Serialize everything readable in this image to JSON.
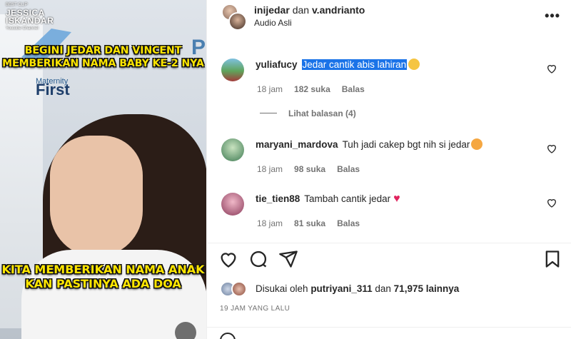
{
  "media": {
    "brand_name": "JESSICA ISKANDAR",
    "brand_sub": "Youtube Channel",
    "brand_tag": "BEST CLIP",
    "backdrop_word": "Maternity",
    "backdrop_word2": "First",
    "backdrop_letter": "P",
    "caption_top_line1": "BEGINI JEDAR DAN VINCENT",
    "caption_top_line2": "MEMBERIKAN NAMA BABY KE-2 NYA",
    "caption_bottom_line1": "KITA MEMBERIKAN NAMA ANAK",
    "caption_bottom_line2": "KAN PASTINYA ADA DOA"
  },
  "header": {
    "user1": "inijedar",
    "joiner": "dan",
    "user2": "v.andrianto",
    "audio": "Audio Asli",
    "more_icon": "more-horizontal-icon"
  },
  "comments": [
    {
      "username": "yuliafucy",
      "text": "Jedar cantik abis lahiran",
      "emoji": "clapping-hands",
      "time": "18 jam",
      "likes": "182 suka",
      "reply": "Balas",
      "view_replies": "Lihat balasan (4)"
    },
    {
      "username": "maryani_mardova",
      "text": "Tuh jadi cakep bgt nih si jedar",
      "emoji": "star-struck",
      "time": "18 jam",
      "likes": "98 suka",
      "reply": "Balas"
    },
    {
      "username": "tie_tien88",
      "text": "Tambah cantik jedar",
      "emoji": "red-heart",
      "time": "18 jam",
      "likes": "81 suka",
      "reply": "Balas"
    }
  ],
  "likes": {
    "prefix": "Disukai oleh",
    "user": "putriyani_311",
    "middle": "dan",
    "count": "71,975",
    "suffix": "lainnya"
  },
  "timestamp": "19 JAM YANG LALU",
  "colors": {
    "selection": "#1a73e8",
    "caption": "#ffe600",
    "muted": "#737373"
  }
}
